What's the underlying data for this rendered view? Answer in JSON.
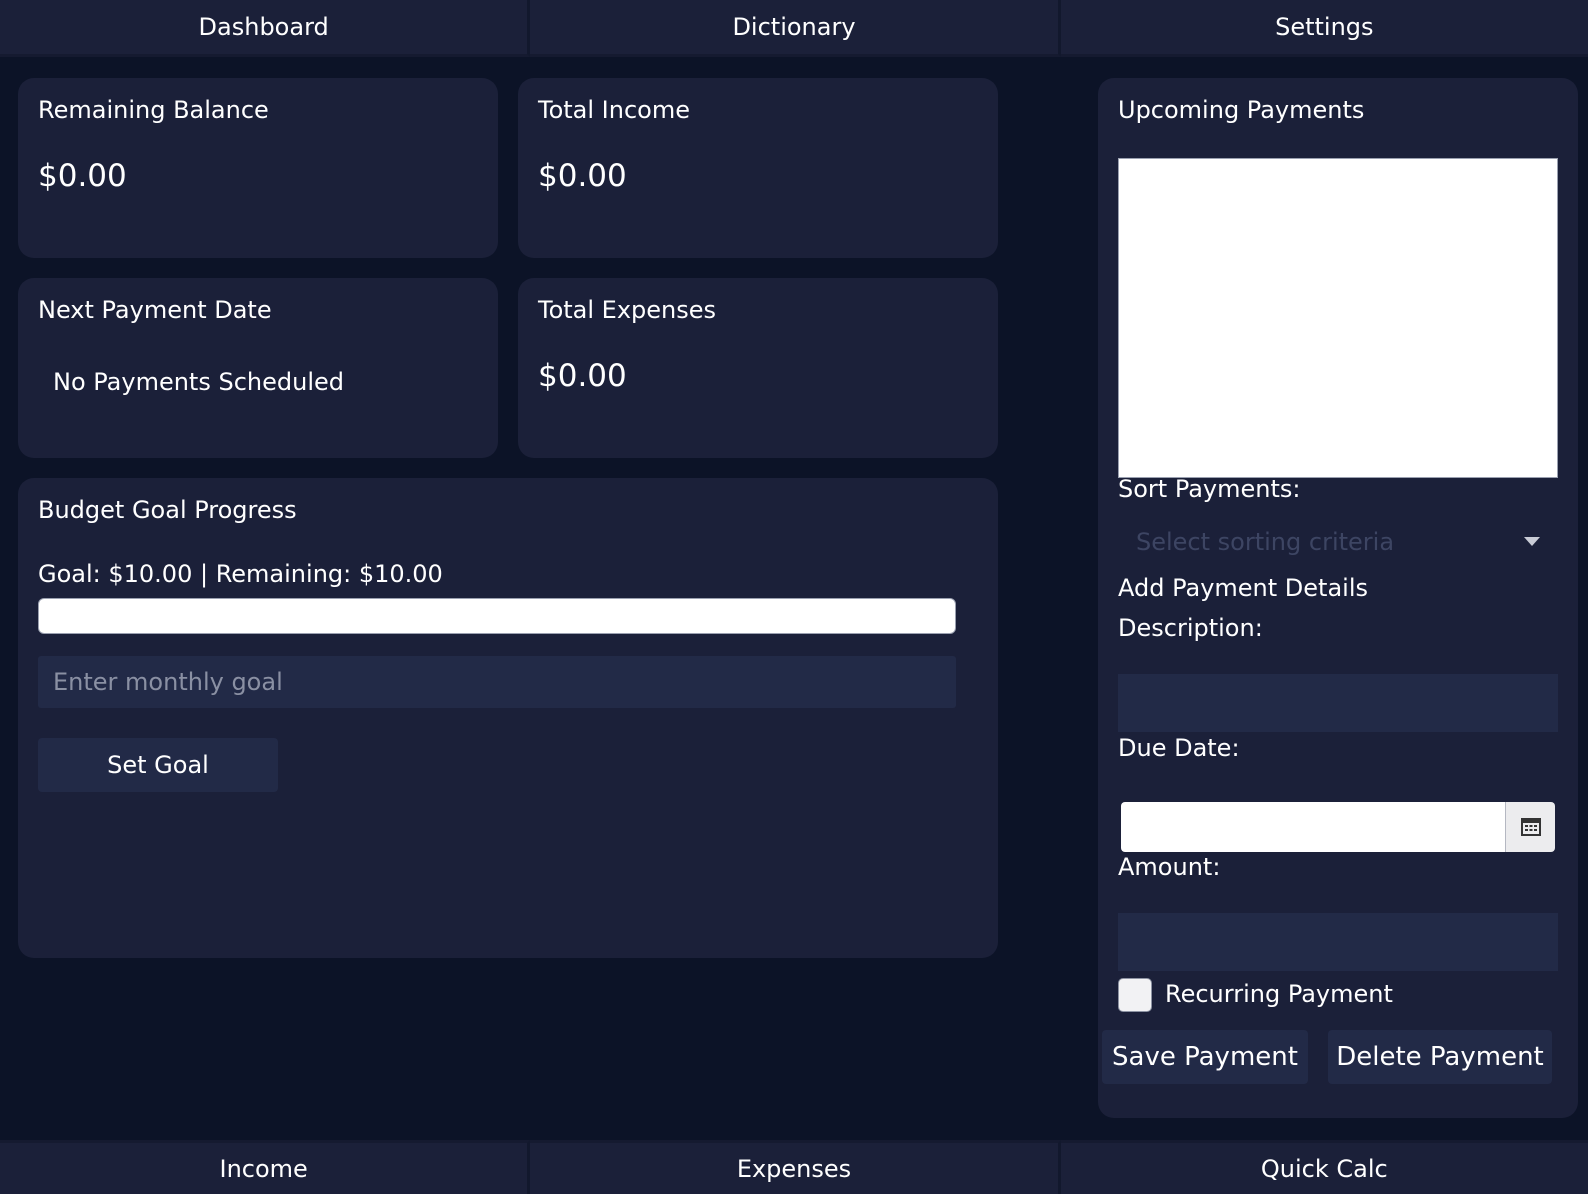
{
  "nav_top": [
    "Dashboard",
    "Dictionary",
    "Settings"
  ],
  "nav_bottom": [
    "Income",
    "Expenses",
    "Quick Calc"
  ],
  "remaining_balance": {
    "title": "Remaining Balance",
    "value": "$0.00"
  },
  "total_income": {
    "title": "Total Income",
    "value": "$0.00"
  },
  "next_payment": {
    "title": "Next Payment Date",
    "value": "No Payments Scheduled"
  },
  "total_expenses": {
    "title": "Total Expenses",
    "value": "$0.00"
  },
  "budget_goal": {
    "title": "Budget Goal Progress",
    "status": "Goal: $10.00 | Remaining: $10.00",
    "progress": 0,
    "input_placeholder": "Enter monthly goal",
    "set_button": "Set Goal"
  },
  "upcoming": {
    "title": "Upcoming Payments",
    "sort_label": "Sort Payments:",
    "sort_placeholder": "Select sorting criteria",
    "add_title": "Add Payment Details",
    "description_label": "Description:",
    "due_date_label": "Due Date:",
    "amount_label": "Amount:",
    "recurring_label": "Recurring Payment",
    "save_button": "Save Payment",
    "delete_button": "Delete Payment"
  },
  "icons": {
    "calendar": "calendar-icon",
    "dropdown": "chevron-down-icon"
  },
  "colors": {
    "background": "#0c1327",
    "panel": "#1b2039",
    "input": "#222a47"
  }
}
